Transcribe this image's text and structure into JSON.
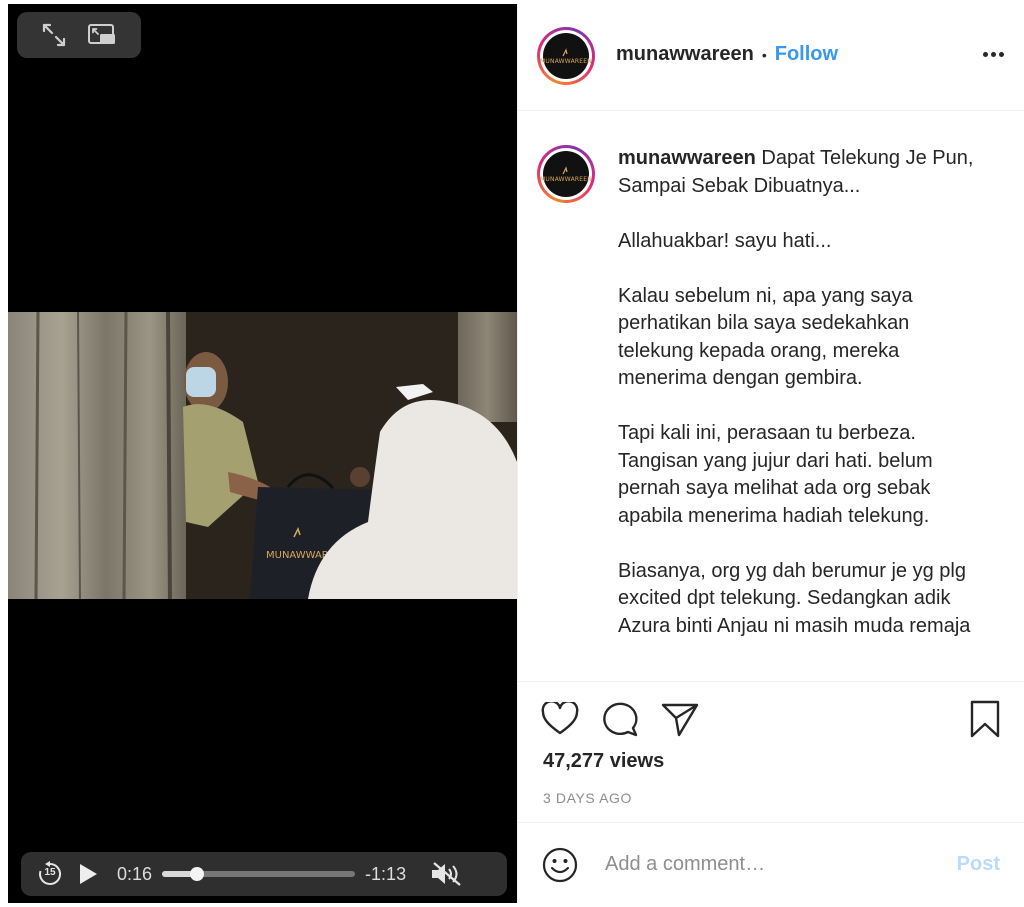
{
  "video": {
    "current_time": "0:16",
    "remaining_time": "-1:13",
    "progress": 0.18,
    "skip_back_seconds": "15",
    "bag_logo_text": "MUNAWWAREEN"
  },
  "header": {
    "username": "munawwareen",
    "separator": "•",
    "follow_label": "Follow",
    "avatar_brand": "MUNAWWAREEN"
  },
  "caption": {
    "username": "munawwareen",
    "text": " Dapat Telekung Je Pun, Sampai Sebak Dibuatnya...\n\nAllahuakbar! sayu hati...\n\nKalau sebelum ni, apa yang saya perhatikan bila saya sedekahkan telekung kepada orang, mereka menerima dengan gembira.\n\nTapi kali ini, perasaan tu berbeza. Tangisan yang jujur dari hati. belum pernah saya melihat ada org sebak apabila menerima hadiah telekung.\n\nBiasanya, org yg dah berumur je yg plg excited dpt telekung. Sedangkan adik Azura binti Anjau ni masih muda remaja"
  },
  "stats": {
    "views": "47,277 views",
    "posted": "3 DAYS AGO"
  },
  "comment": {
    "placeholder": "Add a comment…",
    "post_label": "Post"
  },
  "colors": {
    "follow_blue": "#3897f0",
    "post_disabled": "#b9dcfb",
    "muted_gray": "#8e8e8e"
  }
}
